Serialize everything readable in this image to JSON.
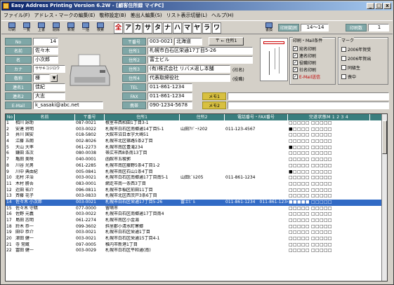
{
  "window": {
    "title": "Easy Address Printing Version 6.2W - [顧客住所録 マイPC]",
    "min": "_",
    "max": "□",
    "close": "x"
  },
  "menu": [
    "ファイル(F)",
    "アドレス・マークの編集(E)",
    "敬称設定(B)",
    "差出人編集(S)",
    "リスト表示切替(L)",
    "ヘルプ(H)"
  ],
  "toolbar": {
    "buttons": [
      "印刷",
      "一覧",
      "上書",
      "削除",
      "新規",
      "一括",
      "検索",
      "書換"
    ],
    "kana": [
      "全",
      "ア",
      "カ",
      "サ",
      "タ",
      "ナ",
      "ハ",
      "マ",
      "ヤ",
      "ラ",
      "ワ"
    ],
    "print_range_label": "印刷範囲",
    "print_range_value": "14～14",
    "print_count_label": "印刷数",
    "print_count_value": "1"
  },
  "form": {
    "no_label": "No",
    "no_value": "14",
    "name_label": "名前",
    "name_value": "佐々木",
    "name2_label": "名",
    "name2_value": "小次郎",
    "kana_label": "カナ",
    "kana_value": "ササキコジロウ",
    "honorific_label": "敬称",
    "honorific_value": "様",
    "joint1_label": "連名1",
    "joint1_value": "佳紀",
    "joint2_label": "連名2",
    "joint2_value": "大志",
    "email_label": "E-Mail",
    "email_value": "k_sasaki@abc.net",
    "zip_label": "〒番号",
    "zip_value": "003-0021",
    "pref_value": "北海道",
    "zip_button": "〒 ← 住所1",
    "addr1_label": "住所1",
    "addr1_value": "札幌市白石区栄通17丁目5-26",
    "addr2_label": "住所2",
    "addr2_value": "富士ビル",
    "addr3_label": "住所3",
    "addr3_value": "(有)株式会社 リバメ返し本舗",
    "addr3_note": "(社名)",
    "addr4_label": "住所4",
    "addr4_value": "代表取締役社",
    "addr4_note": "(役職)",
    "tel_label": "TEL",
    "tel_value": "011-861-1234",
    "fax_label": "FAX",
    "fax_value": "011-861-1234",
    "mobile_label": "携帯",
    "mobile_value": "090-1234-5678",
    "memo1_label": "メモ1",
    "memo1_value": "",
    "memo2_label": "メモ2",
    "memo2_value": ""
  },
  "print_conditions": {
    "title": "印刷・Mail条件",
    "items": [
      {
        "label": "宛名印刷",
        "checked": true
      },
      {
        "label": "連名印刷",
        "checked": true
      },
      {
        "label": "役職印刷",
        "checked": true
      },
      {
        "label": "社名印刷",
        "checked": true
      },
      {
        "label": "E-Mail送信",
        "checked": true,
        "red": true
      }
    ]
  },
  "marks": {
    "title": "マーク",
    "items": [
      {
        "label": "2006年賀受",
        "checked": false
      },
      {
        "label": "2006年賀出",
        "checked": false
      },
      {
        "label": "同級生",
        "checked": false
      },
      {
        "label": "喪中",
        "checked": false
      }
    ]
  },
  "list": {
    "headers": [
      "No",
      "名前",
      "〒番号",
      "住所1",
      "住所2",
      "電話番号・FAX番号",
      "完遂状態M 1 2 3 4"
    ],
    "rows": [
      [
        "1",
        "相川 詠助",
        "087-0021",
        "根室市西和田1丁目3-1",
        "",
        "",
        "□□□□□ □□□□□"
      ],
      [
        "2",
        "安達 将明",
        "003-0022",
        "札幌市白石区南郷通14丁目5-1",
        "山田ｱﾊﾟｰﾄ202",
        "011-123-4567",
        "■□□□□ □□□□□"
      ],
      [
        "3",
        "井川 国安",
        "018-5802",
        "大館市沼日本字大崎51",
        "",
        "",
        "□□□□□ □□□□□"
      ],
      [
        "4",
        "江藤 五朗",
        "002-8026",
        "札幌市北区篠路5条2丁目",
        "",
        "",
        "□□□□□ □□□□□"
      ],
      [
        "5",
        "大山 大率",
        "061-2273",
        "札幌市南区豊滝234",
        "",
        "",
        "■□□□□ □□□□□"
      ],
      [
        "6",
        "鎌田 浩次",
        "080-0038",
        "帯広市西8条南13丁目",
        "",
        "",
        "□□□□□ □□□□□"
      ],
      [
        "7",
        "亀田 美咲",
        "040-0001",
        "函館市五稜郭",
        "",
        "",
        "□□□□□ □□□□□"
      ],
      [
        "8",
        "川谷 光男",
        "061-2285",
        "札幌市南区藤野5条4丁目1-2",
        "",
        "",
        "□□□□□ □□□□□"
      ],
      [
        "9",
        "川中 典由紀",
        "005-0841",
        "札幌市南区石山1条4丁目",
        "",
        "",
        "■□□□□ □□□□□"
      ],
      [
        "10",
        "北村 洋治",
        "003-0021",
        "札幌市白石区南郷通17丁目南5-1",
        "山田ﾋﾞﾙ205",
        "011-861-1234",
        "□□□□□ □□□□□"
      ],
      [
        "11",
        "木村 勝吾",
        "083-0001",
        "網走市南一条西3丁目",
        "",
        "",
        "□□□□□ □□□□□"
      ],
      [
        "12",
        "近田 祐介",
        "096-0811",
        "札幌市手稲区前田11丁目",
        "",
        "",
        "□□□□□ □□□□□"
      ],
      [
        "13",
        "斉藤 花子",
        "003-0833",
        "札幌市北区西茨戸3条6丁目",
        "",
        "",
        "□□□□□ □□□□□"
      ],
      [
        "14",
        "佐々木 小次郎",
        "003-0021",
        "札幌市白石区栄通17丁目5-26",
        "富士ﾋﾞﾙ",
        "011-861-1234　011-861-1234",
        "■■■■■ □□□□□"
      ],
      [
        "15",
        "佐々木 守暗",
        "077-0000",
        "留萌市",
        "",
        "",
        "□□□□□ □□□□□"
      ],
      [
        "16",
        "佐野 元義",
        "003-0022",
        "札幌市白石区南郷通17丁目南4",
        "",
        "",
        "□□□□□ □□□□□"
      ],
      [
        "17",
        "島田 志明",
        "061-2274",
        "札幌市南区小金湯",
        "",
        "",
        "□□□□□ □□□□□"
      ],
      [
        "18",
        "鈴木 恭一",
        "099-3602",
        "斜里郡小清水町寒郷",
        "",
        "",
        "□□□□□ □□□□□"
      ],
      [
        "19",
        "田中 恭介",
        "003-0021",
        "札幌市白石区栄通1丁目",
        "",
        "",
        "□□□□□ □□□□□"
      ],
      [
        "20",
        "津田 健一",
        "003-0021",
        "札幌市白石区栄通15丁目4-1",
        "",
        "",
        "□□□□□ □□□□□"
      ],
      [
        "21",
        "寺 常蔵",
        "097-0005",
        "稚内市新港1丁目",
        "",
        "",
        "□□□□□ □□□□□"
      ],
      [
        "22",
        "冨田 健一",
        "003-0029",
        "札幌市白石区平和通(南)",
        "",
        "",
        "□□□□□ □□□□□"
      ]
    ]
  }
}
